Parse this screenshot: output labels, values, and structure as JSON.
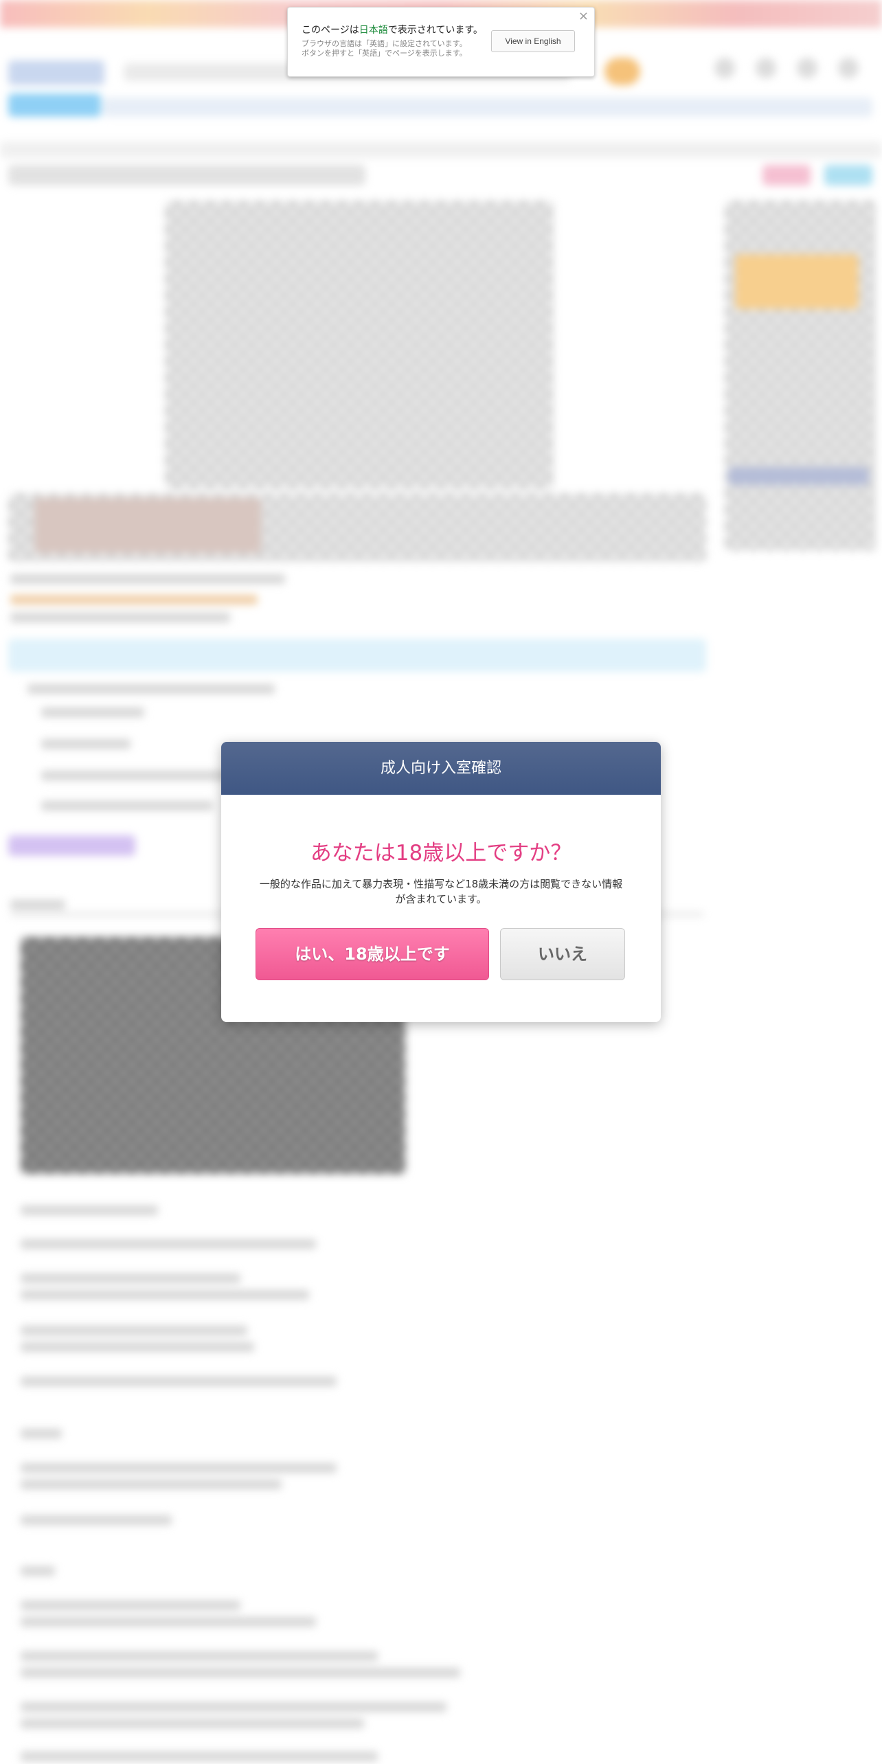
{
  "language_notice": {
    "message_prefix": "このページは",
    "language": "日本語",
    "message_suffix": "で表示されています。",
    "sub_line1": "ブラウザの言語は「英語」に設定されています。",
    "sub_line2": "ボタンを押すと「英語」でページを表示します。",
    "button_label": "View in English",
    "close_icon": "×"
  },
  "age_modal": {
    "title": "成人向け入室確認",
    "question": "あなたは18歳以上ですか？",
    "description_line1": "一般的な作品に加えて暴力表現・性描写など18歳未満の方は閲覧できない情報",
    "description_line2": "が含まれています。",
    "yes_label": "はい、18歳以上です",
    "no_label": "いいえ"
  },
  "colors": {
    "modal_header": "#48608b",
    "question_text": "#e33e83",
    "yes_button": "#f96b9f",
    "no_button": "#eeeeee",
    "language_highlight": "#1b8a3a"
  }
}
